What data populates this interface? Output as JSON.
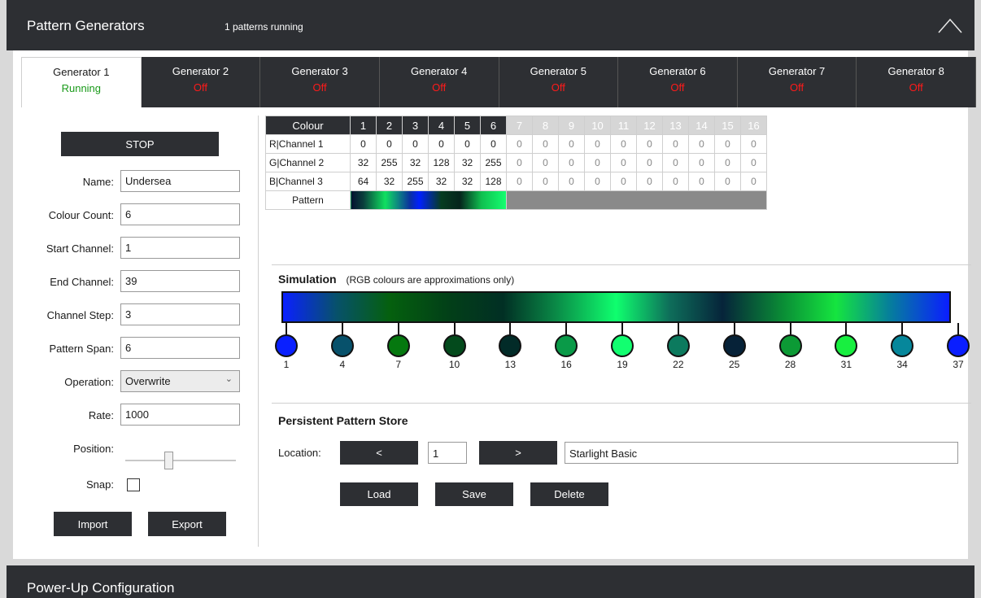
{
  "header": {
    "title": "Pattern Generators",
    "status": "1 patterns running"
  },
  "tabs": [
    {
      "label": "Generator 1",
      "state": "Running"
    },
    {
      "label": "Generator 2",
      "state": "Off"
    },
    {
      "label": "Generator 3",
      "state": "Off"
    },
    {
      "label": "Generator 4",
      "state": "Off"
    },
    {
      "label": "Generator 5",
      "state": "Off"
    },
    {
      "label": "Generator 6",
      "state": "Off"
    },
    {
      "label": "Generator 7",
      "state": "Off"
    },
    {
      "label": "Generator 8",
      "state": "Off"
    }
  ],
  "form": {
    "stop_label": "STOP",
    "name_label": "Name:",
    "name_value": "Undersea",
    "colour_count_label": "Colour Count:",
    "colour_count_value": "6",
    "start_channel_label": "Start Channel:",
    "start_channel_value": "1",
    "end_channel_label": "End Channel:",
    "end_channel_value": "39",
    "channel_step_label": "Channel Step:",
    "channel_step_value": "3",
    "pattern_span_label": "Pattern Span:",
    "pattern_span_value": "6",
    "operation_label": "Operation:",
    "operation_value": "Overwrite",
    "rate_label": "Rate:",
    "rate_value": "1000",
    "position_label": "Position:",
    "position_fraction": 0.38,
    "snap_label": "Snap:",
    "snap_checked": false,
    "import_label": "Import",
    "export_label": "Export"
  },
  "colour_table": {
    "header_label": "Colour",
    "columns": [
      "1",
      "2",
      "3",
      "4",
      "5",
      "6",
      "7",
      "8",
      "9",
      "10",
      "11",
      "12",
      "13",
      "14",
      "15",
      "16"
    ],
    "active_columns": 6,
    "rows": [
      {
        "label": "R|Channel 1",
        "values": [
          "0",
          "0",
          "0",
          "0",
          "0",
          "0",
          "0",
          "0",
          "0",
          "0",
          "0",
          "0",
          "0",
          "0",
          "0",
          "0"
        ]
      },
      {
        "label": "G|Channel 2",
        "values": [
          "32",
          "255",
          "32",
          "128",
          "32",
          "255",
          "0",
          "0",
          "0",
          "0",
          "0",
          "0",
          "0",
          "0",
          "0",
          "0"
        ]
      },
      {
        "label": "B|Channel 3",
        "values": [
          "64",
          "32",
          "255",
          "32",
          "32",
          "128",
          "0",
          "0",
          "0",
          "0",
          "0",
          "0",
          "0",
          "0",
          "0",
          "0"
        ]
      }
    ],
    "pattern_label": "Pattern"
  },
  "simulation": {
    "title": "Simulation",
    "note": "(RGB colours are approximations only)",
    "markers": [
      {
        "channel": "1",
        "color": "#0a20ff"
      },
      {
        "channel": "4",
        "color": "#07516b"
      },
      {
        "channel": "7",
        "color": "#05780f"
      },
      {
        "channel": "10",
        "color": "#034a1c"
      },
      {
        "channel": "13",
        "color": "#022b28"
      },
      {
        "channel": "16",
        "color": "#0a9a48"
      },
      {
        "channel": "19",
        "color": "#12ff70"
      },
      {
        "channel": "22",
        "color": "#0c7a5e"
      },
      {
        "channel": "25",
        "color": "#062238"
      },
      {
        "channel": "28",
        "color": "#0c9a35"
      },
      {
        "channel": "31",
        "color": "#18ef40"
      },
      {
        "channel": "34",
        "color": "#06879b"
      },
      {
        "channel": "37",
        "color": "#0a1eff"
      }
    ]
  },
  "store": {
    "title": "Persistent Pattern Store",
    "location_label": "Location:",
    "prev_label": "<",
    "next_label": ">",
    "location_value": "1",
    "pattern_name": "Starlight Basic",
    "load_label": "Load",
    "save_label": "Save",
    "delete_label": "Delete"
  },
  "footer": {
    "title": "Power-Up Configuration"
  }
}
